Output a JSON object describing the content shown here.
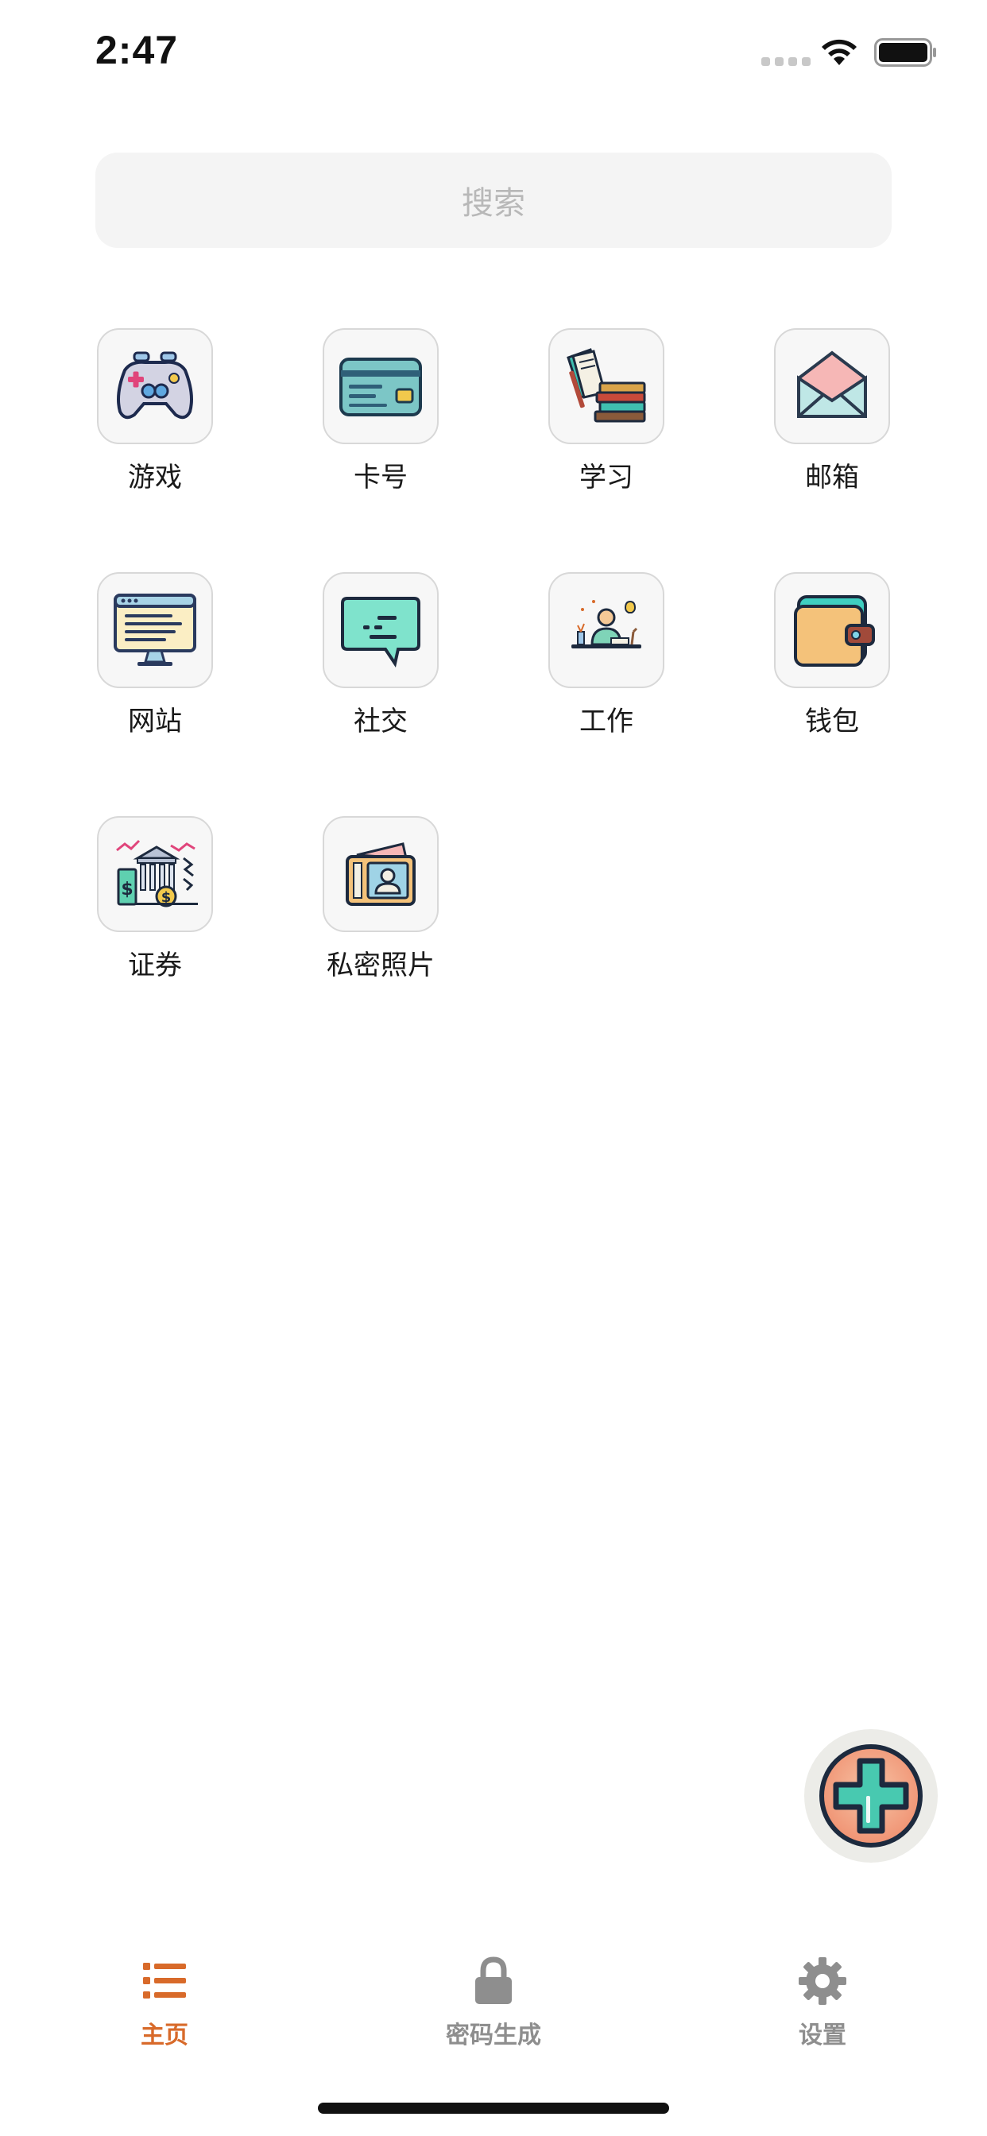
{
  "status_bar": {
    "time": "2:47"
  },
  "search": {
    "placeholder": "搜索"
  },
  "categories": [
    {
      "label": "游戏",
      "icon": "gamepad-icon"
    },
    {
      "label": "卡号",
      "icon": "credit-card-icon"
    },
    {
      "label": "学习",
      "icon": "books-icon"
    },
    {
      "label": "邮箱",
      "icon": "envelope-icon"
    },
    {
      "label": "网站",
      "icon": "monitor-icon"
    },
    {
      "label": "社交",
      "icon": "chat-bubble-icon"
    },
    {
      "label": "工作",
      "icon": "desk-worker-icon"
    },
    {
      "label": "钱包",
      "icon": "wallet-icon"
    },
    {
      "label": "证券",
      "icon": "bank-stock-icon"
    },
    {
      "label": "私密照片",
      "icon": "photo-id-icon"
    }
  ],
  "fab": {
    "icon": "plus-icon"
  },
  "tabs": [
    {
      "label": "主页",
      "icon": "list-icon",
      "active": true
    },
    {
      "label": "密码生成",
      "icon": "lock-icon",
      "active": false
    },
    {
      "label": "设置",
      "icon": "gear-icon",
      "active": false
    }
  ],
  "colors": {
    "accent": "#d86a2a",
    "tab_inactive": "#8e8e8e",
    "search_bg": "#f4f4f4"
  }
}
